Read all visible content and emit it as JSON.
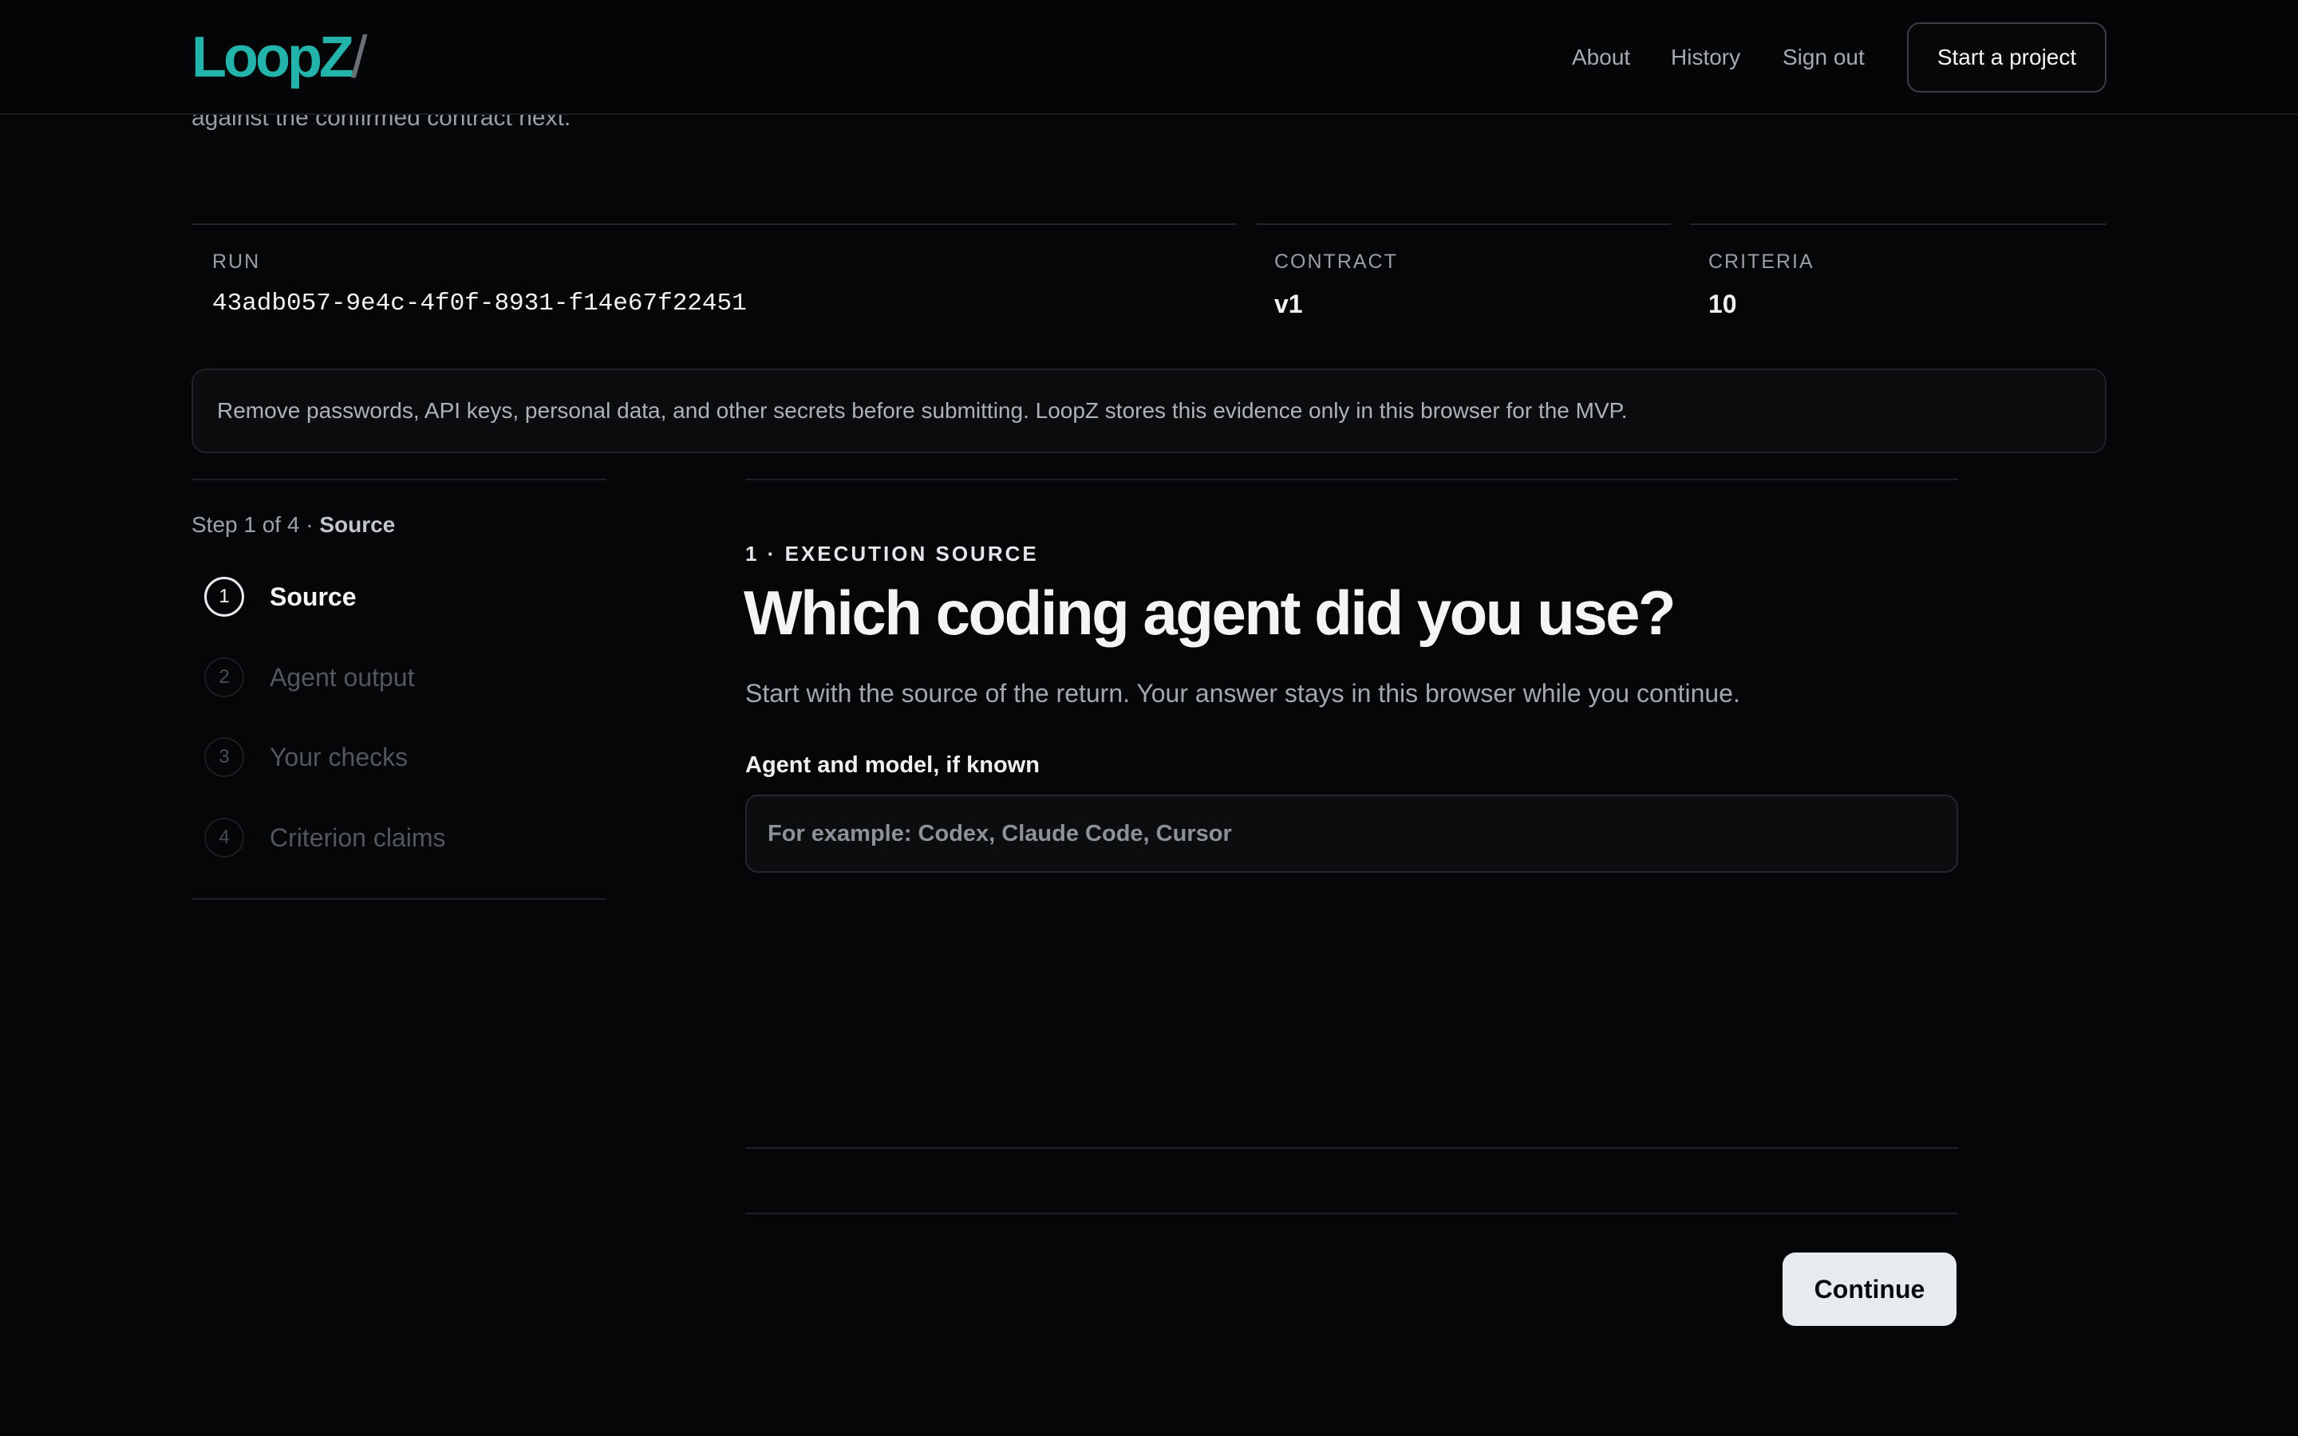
{
  "header": {
    "logo": "LoopZ",
    "logo_separator": "/",
    "nav": {
      "about": "About",
      "history": "History",
      "sign_out": "Sign out"
    },
    "cta": "Start a project"
  },
  "intro": {
    "partial_text": "against the confirmed contract next."
  },
  "meta": {
    "run_label": "RUN",
    "run_value": "43adb057-9e4c-4f0f-8931-f14e67f22451",
    "contract_label": "CONTRACT",
    "contract_value": "v1",
    "criteria_label": "CRITERIA",
    "criteria_value": "10"
  },
  "notice": "Remove passwords, API keys, personal data, and other secrets before submitting. LoopZ stores this evidence only in this browser for the MVP.",
  "steps": {
    "count_prefix": "Step 1 of 4 · ",
    "current_name": "Source",
    "items": [
      {
        "number": "1",
        "label": "Source",
        "state": "active"
      },
      {
        "number": "2",
        "label": "Agent output",
        "state": "upcoming"
      },
      {
        "number": "3",
        "label": "Your checks",
        "state": "upcoming"
      },
      {
        "number": "4",
        "label": "Criterion claims",
        "state": "upcoming"
      }
    ]
  },
  "form": {
    "kicker": "1 · EXECUTION SOURCE",
    "question": "Which coding agent did you use?",
    "lead": "Start with the source of the return. Your answer stays in this browser while you continue.",
    "field_label": "Agent and model, if known",
    "field_value": "",
    "field_placeholder": "For example: Codex, Claude Code, Cursor",
    "continue": "Continue"
  },
  "colors": {
    "background": "#050608",
    "accent": "#23b3ab",
    "button_light": "#e8ebee"
  }
}
